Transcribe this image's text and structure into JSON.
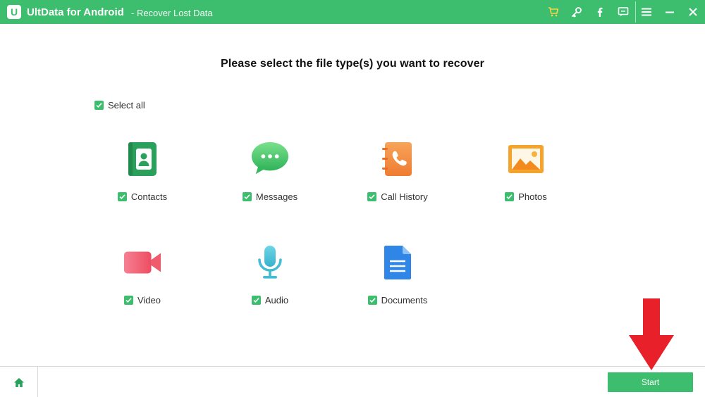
{
  "app": {
    "name": "UltData for Android",
    "subtitle": "- Recover Lost Data",
    "logo_glyph": "U"
  },
  "titlebar_icons": [
    "cart-icon",
    "key-icon",
    "facebook-icon",
    "feedback-icon",
    "menu-icon",
    "minimize-icon",
    "close-icon"
  ],
  "main": {
    "heading": "Please select the file type(s) you want to recover",
    "select_all": {
      "label": "Select all",
      "checked": true
    },
    "file_types": [
      {
        "key": "contacts",
        "label": "Contacts",
        "checked": true,
        "icon": "contacts-icon",
        "color": "#2aa05a"
      },
      {
        "key": "messages",
        "label": "Messages",
        "checked": true,
        "icon": "messages-icon",
        "color": "#4cc96a"
      },
      {
        "key": "call_history",
        "label": "Call History",
        "checked": true,
        "icon": "call-history-icon",
        "color": "#f28a3a"
      },
      {
        "key": "photos",
        "label": "Photos",
        "checked": true,
        "icon": "photos-icon",
        "color": "#f5a623"
      },
      {
        "key": "video",
        "label": "Video",
        "checked": true,
        "icon": "video-icon",
        "color": "#f0647a"
      },
      {
        "key": "audio",
        "label": "Audio",
        "checked": true,
        "icon": "audio-icon",
        "color": "#4ec3d8"
      },
      {
        "key": "documents",
        "label": "Documents",
        "checked": true,
        "icon": "documents-icon",
        "color": "#2f86e6"
      }
    ]
  },
  "bottom": {
    "start_label": "Start",
    "home_icon": "home-icon"
  },
  "colors": {
    "accent": "#3cbe6e",
    "arrow": "#e8202a"
  }
}
